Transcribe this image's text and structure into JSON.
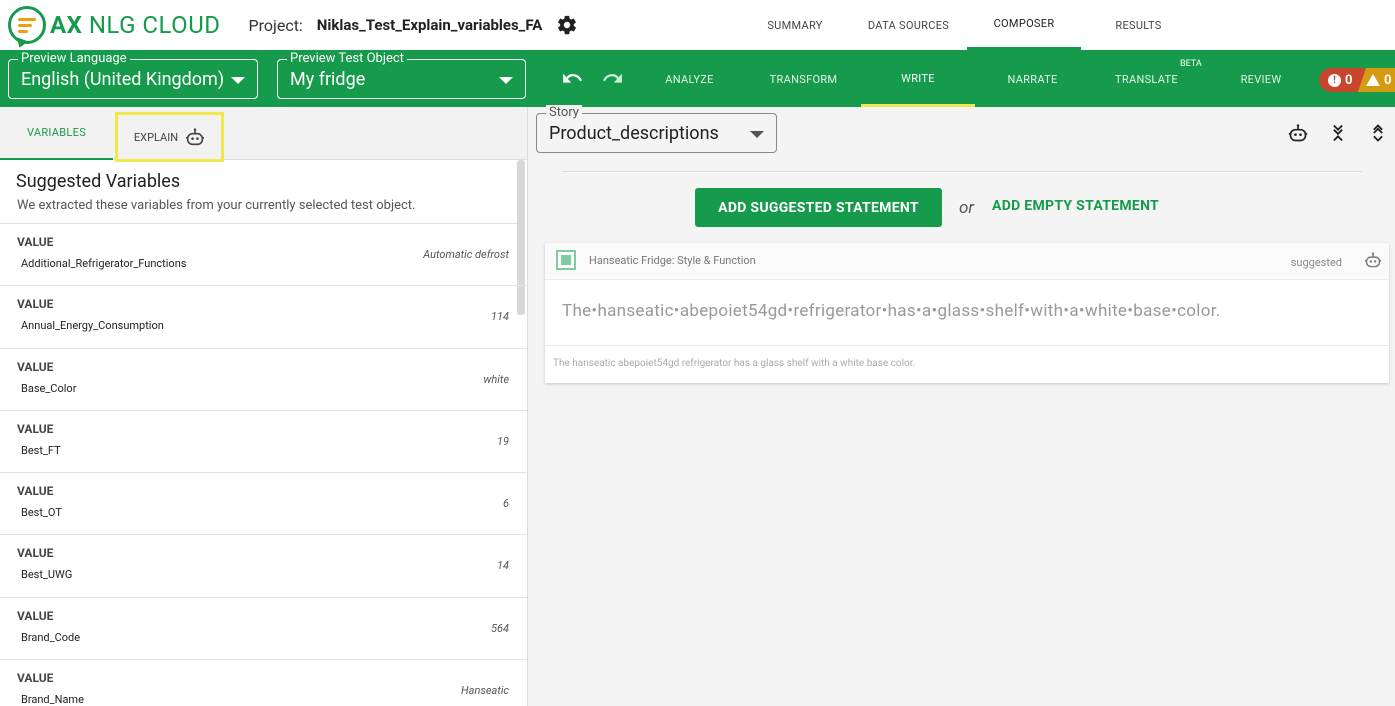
{
  "app": {
    "logo_ax": "AX",
    "logo_rest": "NLG CLOUD",
    "project_label": "Project:",
    "project_name": "Niklas_Test_Explain_variables_FA"
  },
  "topnav": [
    "SUMMARY",
    "DATA SOURCES",
    "COMPOSER",
    "RESULTS"
  ],
  "toolbar": {
    "preview_language_label": "Preview Language",
    "preview_language_value": "English (United Kingdom)",
    "preview_object_label": "Preview Test Object",
    "preview_object_value": "My fridge",
    "tabs": [
      "ANALYZE",
      "TRANSFORM",
      "WRITE",
      "NARRATE",
      "TRANSLATE",
      "REVIEW"
    ],
    "beta": "BETA",
    "errors": "0",
    "warnings": "0"
  },
  "left": {
    "tab_variables": "VARIABLES",
    "tab_explain": "EXPLAIN",
    "title": "Suggested Variables",
    "subtitle": "We extracted these variables from your currently selected test object.",
    "rows": [
      {
        "kind": "VALUE",
        "name": "Additional_Refrigerator_Functions",
        "value": "Automatic defrost"
      },
      {
        "kind": "VALUE",
        "name": "Annual_Energy_Consumption",
        "value": "114"
      },
      {
        "kind": "VALUE",
        "name": "Base_Color",
        "value": "white"
      },
      {
        "kind": "VALUE",
        "name": "Best_FT",
        "value": "19"
      },
      {
        "kind": "VALUE",
        "name": "Best_OT",
        "value": "6"
      },
      {
        "kind": "VALUE",
        "name": "Best_UWG",
        "value": "14"
      },
      {
        "kind": "VALUE",
        "name": "Brand_Code",
        "value": "564"
      },
      {
        "kind": "VALUE",
        "name": "Brand_Name",
        "value": "Hanseatic"
      }
    ]
  },
  "right": {
    "story_label": "Story",
    "story_value": "Product_descriptions",
    "add_suggested": "ADD SUGGESTED STATEMENT",
    "or": "or",
    "add_empty": "ADD EMPTY STATEMENT",
    "card": {
      "title": "Hanseatic Fridge: Style & Function",
      "status": "suggested",
      "text": "The•hanseatic•abepoiet54gd•refrigerator•has•a•glass•shelf•with•a•white•base•color.",
      "preview": "The hanseatic abepoiet54gd refrigerator has a glass shelf with a white base color."
    }
  },
  "colors": {
    "brand": "#169a4b",
    "highlight": "#f0e84a",
    "error": "#c8462e",
    "warning": "#d49a10"
  }
}
